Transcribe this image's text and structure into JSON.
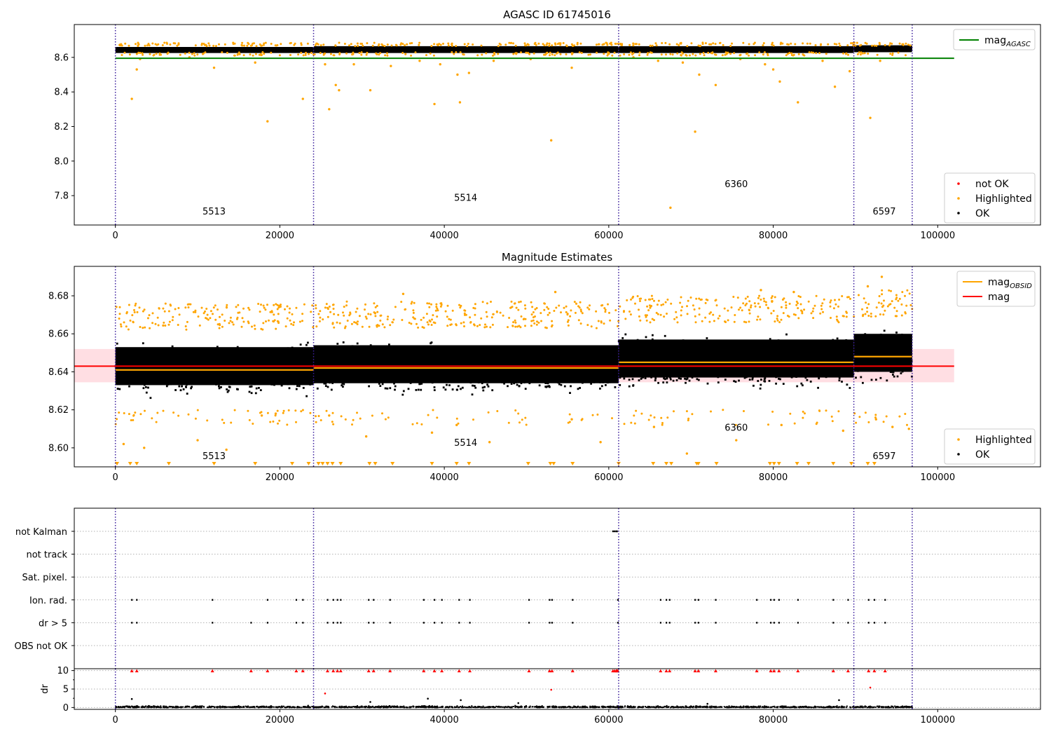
{
  "chart_data": [
    {
      "type": "scatter",
      "title": "AGASC ID 61745016",
      "xlim": [
        -5000,
        112500
      ],
      "ylim": [
        7.63,
        8.79
      ],
      "xticks": [
        0,
        20000,
        40000,
        60000,
        80000,
        100000
      ],
      "yticks": [
        7.8,
        8.0,
        8.2,
        8.4,
        8.6
      ],
      "ytick_labels": [
        "7.8",
        "8.0",
        "8.2",
        "8.4",
        "8.6"
      ],
      "obsid_boundaries": [
        0,
        24100,
        61200,
        89800,
        96900
      ],
      "obsid_labels": [
        {
          "text": "5513",
          "x": 12000,
          "y": 7.69
        },
        {
          "text": "5514",
          "x": 42600,
          "y": 7.77
        },
        {
          "text": "6360",
          "x": 75500,
          "y": 7.85
        },
        {
          "text": "6597",
          "x": 93500,
          "y": 7.69
        }
      ],
      "band_segments": [
        {
          "x0": 0,
          "x1": 24100,
          "y0": 8.625,
          "y1": 8.66
        },
        {
          "x0": 24100,
          "x1": 61200,
          "y0": 8.625,
          "y1": 8.665
        },
        {
          "x0": 61200,
          "x1": 89800,
          "y0": 8.625,
          "y1": 8.665
        },
        {
          "x0": 89800,
          "x1": 96900,
          "y0": 8.63,
          "y1": 8.67
        }
      ],
      "series": [
        {
          "name": "mag_AGASC",
          "type": "hline",
          "value": 8.595,
          "x0": 0,
          "x1": 102000,
          "color": "#008000"
        },
        {
          "name": "not OK",
          "type": "scatter",
          "color": "#ff0000",
          "values": []
        },
        {
          "name": "Highlighted",
          "type": "scatter",
          "color": "#ffa500",
          "values": [
            [
              2000,
              8.36
            ],
            [
              2600,
              8.53
            ],
            [
              18500,
              8.23
            ],
            [
              22800,
              8.36
            ],
            [
              25500,
              8.56
            ],
            [
              26000,
              8.3
            ],
            [
              26800,
              8.44
            ],
            [
              27200,
              8.41
            ],
            [
              31000,
              8.41
            ],
            [
              38800,
              8.33
            ],
            [
              41600,
              8.5
            ],
            [
              41900,
              8.34
            ],
            [
              43000,
              8.51
            ],
            [
              53000,
              8.12
            ],
            [
              67500,
              7.73
            ],
            [
              70500,
              8.17
            ],
            [
              71000,
              8.5
            ],
            [
              73000,
              8.44
            ],
            [
              80000,
              8.53
            ],
            [
              80800,
              8.46
            ],
            [
              83000,
              8.34
            ],
            [
              87500,
              8.43
            ],
            [
              89300,
              8.52
            ],
            [
              91800,
              8.25
            ],
            [
              3000,
              8.59
            ],
            [
              9000,
              8.6
            ],
            [
              12000,
              8.54
            ],
            [
              17000,
              8.57
            ],
            [
              29000,
              8.56
            ],
            [
              33500,
              8.55
            ],
            [
              37000,
              8.58
            ],
            [
              39500,
              8.56
            ],
            [
              46000,
              8.58
            ],
            [
              50500,
              8.59
            ],
            [
              55500,
              8.54
            ],
            [
              63000,
              8.6
            ],
            [
              66000,
              8.58
            ],
            [
              69000,
              8.57
            ],
            [
              76000,
              8.59
            ],
            [
              79000,
              8.56
            ],
            [
              86000,
              8.58
            ],
            [
              93000,
              8.58
            ]
          ]
        },
        {
          "name": "OK",
          "type": "scatter",
          "color": "#000000",
          "values": []
        }
      ],
      "legend_upper": {
        "position": "top-right",
        "entries": [
          {
            "label": "mag",
            "sub": "AGASC",
            "color": "#008000"
          }
        ]
      },
      "legend_lower": {
        "position": "bottom-right",
        "entries": [
          {
            "label": "not OK",
            "color": "#ff0000"
          },
          {
            "label": "Highlighted",
            "color": "#ffa500"
          },
          {
            "label": "OK",
            "color": "#000000"
          }
        ]
      }
    },
    {
      "type": "scatter",
      "title": "Magnitude Estimates",
      "xlim": [
        -5000,
        112500
      ],
      "ylim": [
        8.59,
        8.6955
      ],
      "xticks": [
        0,
        20000,
        40000,
        60000,
        80000,
        100000
      ],
      "yticks": [
        8.6,
        8.62,
        8.64,
        8.66,
        8.68
      ],
      "ytick_labels": [
        "8.60",
        "8.62",
        "8.64",
        "8.66",
        "8.68"
      ],
      "obsid_boundaries": [
        0,
        24100,
        61200,
        89800,
        96900
      ],
      "obsid_labels": [
        {
          "text": "5513",
          "x": 12000,
          "y": 8.594
        },
        {
          "text": "5514",
          "x": 42600,
          "y": 8.601
        },
        {
          "text": "6360",
          "x": 75500,
          "y": 8.609
        },
        {
          "text": "6597",
          "x": 93500,
          "y": 8.594
        }
      ],
      "mag_band": {
        "y0": 8.6345,
        "y1": 8.652,
        "x0": -5000,
        "x1": 102000,
        "color": "#ffb6c1"
      },
      "series": [
        {
          "name": "mag_OBSID",
          "type": "step",
          "color": "#ffa500",
          "segments": [
            {
              "x0": 0,
              "x1": 24100,
              "y": 8.641
            },
            {
              "x0": 24100,
              "x1": 61200,
              "y": 8.642
            },
            {
              "x0": 61200,
              "x1": 89800,
              "y": 8.645
            },
            {
              "x0": 89800,
              "x1": 96900,
              "y": 8.648
            }
          ]
        },
        {
          "name": "mag",
          "type": "hline",
          "value": 8.643,
          "color": "#ff0000"
        },
        {
          "name": "Highlighted",
          "type": "scatter",
          "color": "#ffa500",
          "values": [
            [
              1000,
              8.602
            ],
            [
              3500,
              8.6
            ],
            [
              10000,
              8.604
            ],
            [
              13500,
              8.599
            ],
            [
              17800,
              8.617
            ],
            [
              19500,
              8.618
            ],
            [
              26000,
              8.617
            ],
            [
              30500,
              8.606
            ],
            [
              38500,
              8.608
            ],
            [
              41500,
              8.612
            ],
            [
              45500,
              8.603
            ],
            [
              55500,
              8.615
            ],
            [
              59000,
              8.603
            ],
            [
              65500,
              8.611
            ],
            [
              69500,
              8.597
            ],
            [
              75500,
              8.604
            ],
            [
              81000,
              8.612
            ],
            [
              88500,
              8.609
            ],
            [
              92500,
              8.615
            ],
            [
              94500,
              8.611
            ],
            [
              96500,
              8.61
            ],
            [
              35000,
              8.681
            ],
            [
              53500,
              8.682
            ],
            [
              78500,
              8.683
            ],
            [
              82500,
              8.682
            ],
            [
              91500,
              8.685
            ],
            [
              93200,
              8.69
            ]
          ]
        },
        {
          "name": "OK",
          "type": "scatter",
          "color": "#000000",
          "values": []
        }
      ],
      "clipped_markers": [
        {
          "color": "#ffa500",
          "x": [
            200,
            1800,
            2600,
            6500,
            12000,
            17000,
            21500,
            23500,
            24700,
            25200,
            25800,
            26400,
            27400,
            30900,
            31600,
            33700,
            38500,
            41500,
            43000,
            50200,
            52900,
            53300,
            55600,
            61200,
            65400,
            67000,
            67600,
            70700,
            70900,
            73100,
            79600,
            80100,
            80700,
            82900,
            84300,
            87300,
            89500,
            91500,
            92300
          ]
        }
      ],
      "legend_upper": {
        "position": "top-right",
        "entries": [
          {
            "label": "mag",
            "sub": "OBSID",
            "color": "#ffa500"
          },
          {
            "label": "mag",
            "color": "#ff0000"
          }
        ]
      },
      "legend_lower": {
        "position": "bottom-right",
        "entries": [
          {
            "label": "Highlighted",
            "color": "#ffa500"
          },
          {
            "label": "OK",
            "color": "#000000"
          }
        ]
      }
    },
    {
      "type": "scatter",
      "title": "",
      "xlim": [
        -5000,
        112500
      ],
      "xticks": [
        0,
        20000,
        40000,
        60000,
        80000,
        100000
      ],
      "obsid_boundaries": [
        0,
        24100,
        61200,
        89800,
        96900
      ],
      "flag_categories": [
        "not Kalman",
        "not track",
        "Sat. pixel.",
        "Ion. rad.",
        "dr > 5",
        "OBS not OK"
      ],
      "flag_events": {
        "not Kalman": [
          60500,
          60700,
          60900,
          61000
        ],
        "Ion. rad.": [
          2000,
          2600,
          11800,
          18500,
          22000,
          22800,
          25800,
          26500,
          27000,
          27400,
          30800,
          31400,
          33400,
          37500,
          38800,
          39700,
          41800,
          43100,
          50300,
          52800,
          53100,
          55600,
          61100,
          66300,
          67000,
          67400,
          70500,
          70900,
          73000,
          78000,
          79700,
          80100,
          80700,
          83000,
          87300,
          89100,
          91600,
          92300,
          93600
        ],
        "dr > 5": [
          2000,
          2600,
          11800,
          16500,
          18500,
          22000,
          22800,
          25800,
          26500,
          27000,
          27400,
          30800,
          31400,
          33400,
          37500,
          38800,
          39700,
          41800,
          43100,
          50300,
          52800,
          53100,
          55600,
          61100,
          66300,
          67000,
          67400,
          70500,
          70900,
          73000,
          78000,
          79700,
          80100,
          80700,
          83000,
          87300,
          89100,
          91600,
          92300,
          93600
        ]
      },
      "dr_panel": {
        "ylabel": "dr",
        "ylim": [
          -0.5,
          10.5
        ],
        "yticks": [
          0,
          5,
          10
        ],
        "clip_value": 10,
        "clipped_x": [
          2000,
          2600,
          11800,
          16500,
          18500,
          22000,
          22800,
          25800,
          26500,
          27000,
          27400,
          30800,
          31400,
          33400,
          37500,
          38800,
          39700,
          41800,
          43100,
          50300,
          52800,
          53100,
          55600,
          60500,
          60700,
          60900,
          61000,
          61100,
          66300,
          67000,
          67400,
          70500,
          70900,
          73000,
          78000,
          79700,
          80100,
          80700,
          83000,
          87300,
          89100,
          91600,
          92300,
          93600
        ],
        "outliers": [
          [
            2000,
            2.3
          ],
          [
            25500,
            3.8
          ],
          [
            31000,
            1.5
          ],
          [
            38000,
            2.4
          ],
          [
            42000,
            2.0
          ],
          [
            53000,
            4.8
          ],
          [
            88000,
            2.0
          ],
          [
            91800,
            5.4
          ],
          [
            49000,
            1.2
          ],
          [
            72000,
            1.0
          ]
        ]
      }
    }
  ]
}
